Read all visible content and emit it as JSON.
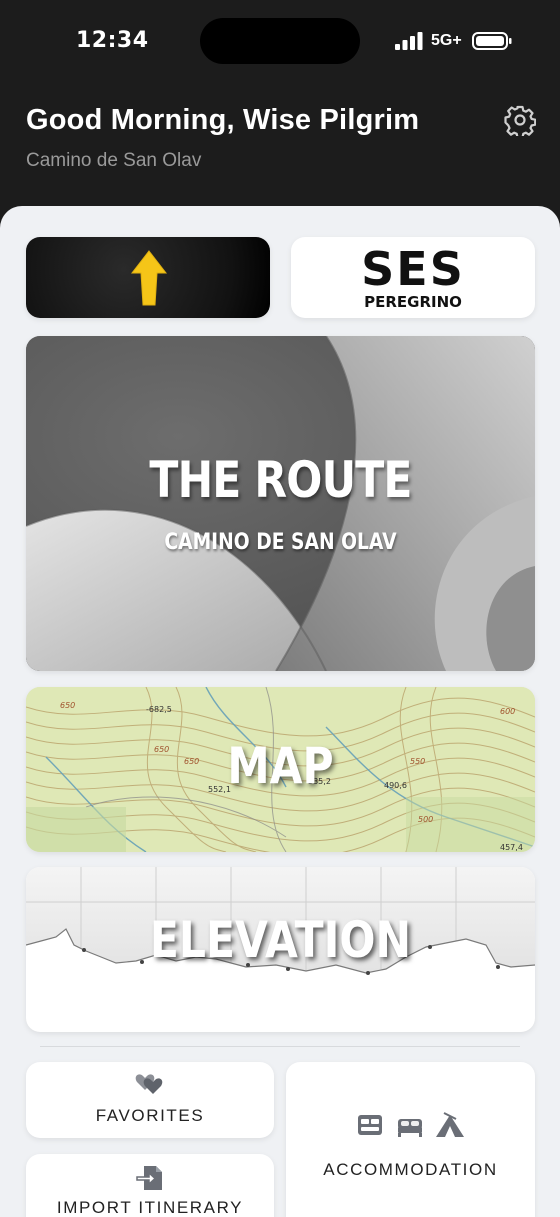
{
  "status_bar": {
    "time": "12:34",
    "network": "5G+",
    "icons": [
      "signal-icon",
      "battery-icon"
    ]
  },
  "header": {
    "greeting": "Good Morning, Wise Pilgrim",
    "subtitle": "Camino de San Olav",
    "settings_icon": "gear-icon"
  },
  "cards": {
    "arrow": {
      "icon": "yellow-arrow-up-icon",
      "accent": "#f5c518"
    },
    "ses": {
      "title": "SES",
      "subtitle": "PEREGRINO"
    },
    "route": {
      "title": "THE ROUTE",
      "subtitle": "CAMINO DE SAN OLAV"
    },
    "map": {
      "title": "MAP",
      "labels": [
        "-682,5",
        "650",
        "650",
        "552,1",
        "535,2",
        "490,6",
        "550",
        "600",
        "500",
        "457,4",
        "650"
      ]
    },
    "elevation": {
      "title": "ELEVATION"
    }
  },
  "tiles": {
    "favorites": {
      "label": "FAVORITES",
      "icon": "hearts-icon"
    },
    "import": {
      "label": "IMPORT ITINERARY",
      "icon": "import-file-icon"
    },
    "accommodation": {
      "label": "ACCOMMODATION",
      "icons": [
        "hostel-bed-icon",
        "bed-icon",
        "tent-icon"
      ]
    }
  }
}
